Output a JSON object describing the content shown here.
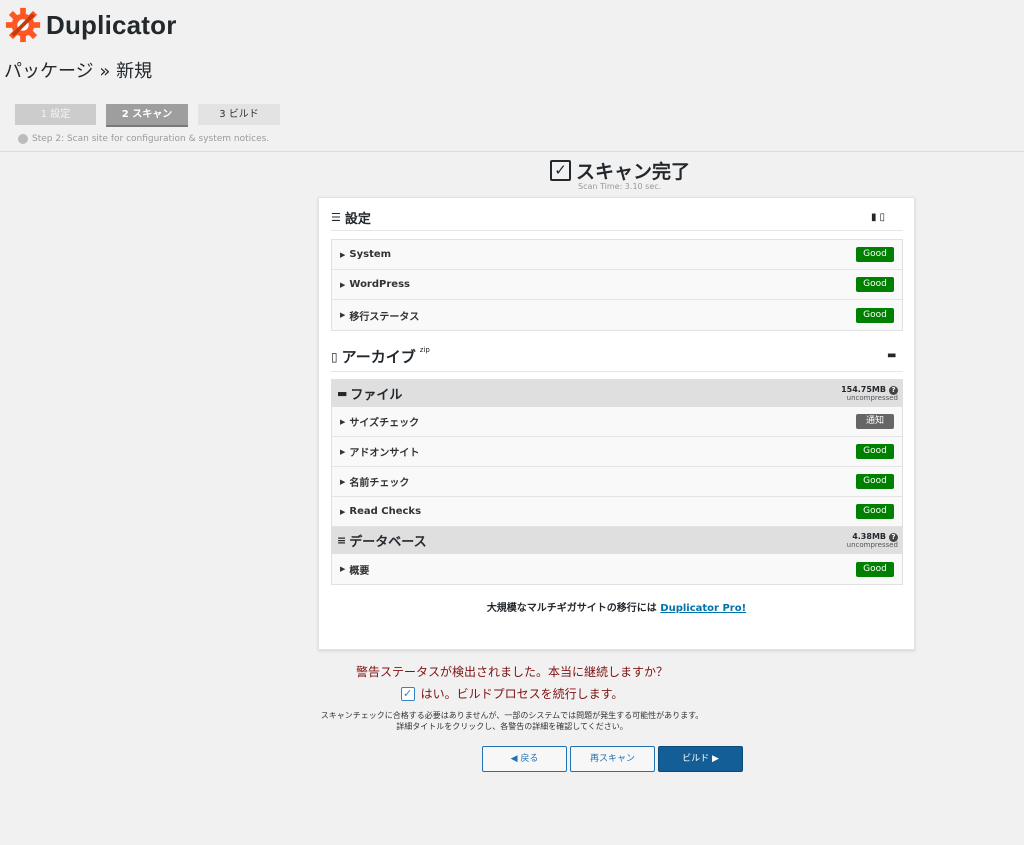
{
  "brand": {
    "name": "Duplicator",
    "accent": "#ff5722"
  },
  "page": {
    "title": "パッケージ » 新規"
  },
  "wizard": {
    "steps": [
      {
        "label": "1 設定",
        "state": "done"
      },
      {
        "label": "2 スキャン",
        "state": "active"
      },
      {
        "label": "3 ビルド",
        "state": "todo"
      }
    ],
    "description": "Step 2: Scan site for configuration & system notices."
  },
  "scan": {
    "title": "スキャン完了",
    "time": "Scan Time: 3.10 sec."
  },
  "settings": {
    "title": "設定",
    "icons": [
      "server-icon",
      "file-icon"
    ],
    "rows": [
      {
        "label": "System",
        "status": "Good"
      },
      {
        "label": "WordPress",
        "status": "Good"
      },
      {
        "label": "移行ステータス",
        "status": "Good"
      }
    ]
  },
  "archive": {
    "title": "アーカイブ",
    "suffix": "zip",
    "files": {
      "title": "ファイル",
      "size": "154.75MB",
      "note": "uncompressed",
      "help": "?",
      "rows": [
        {
          "label": "サイズチェック",
          "status": "通知"
        },
        {
          "label": "アドオンサイト",
          "status": "Good"
        },
        {
          "label": "名前チェック",
          "status": "Good"
        },
        {
          "label": "Read Checks",
          "status": "Good"
        }
      ]
    },
    "database": {
      "title": "データベース",
      "size": "4.38MB",
      "note": "uncompressed",
      "help": "?",
      "rows": [
        {
          "label": "概要",
          "status": "Good"
        }
      ]
    }
  },
  "pro": {
    "text": "大規模なマルチギガサイトの移行には ",
    "link": "Duplicator Pro!"
  },
  "warning": {
    "message": "警告ステータスが検出されました。本当に継続しますか？",
    "confirm": "はい。ビルドプロセスを続行します。",
    "note1": "スキャンチェックに合格する必要はありませんが、一部のシステムでは問題が発生する可能性があります。",
    "note2": "詳細タイトルをクリックし、各警告の詳細を確認してください。"
  },
  "buttons": {
    "back": "◀ 戻る",
    "rescan": "再スキャン",
    "build": "ビルド ▶"
  },
  "colors": {
    "good": "#008000",
    "notice": "#666666",
    "warning_text": "#7f1212",
    "primary": "#135e96"
  }
}
